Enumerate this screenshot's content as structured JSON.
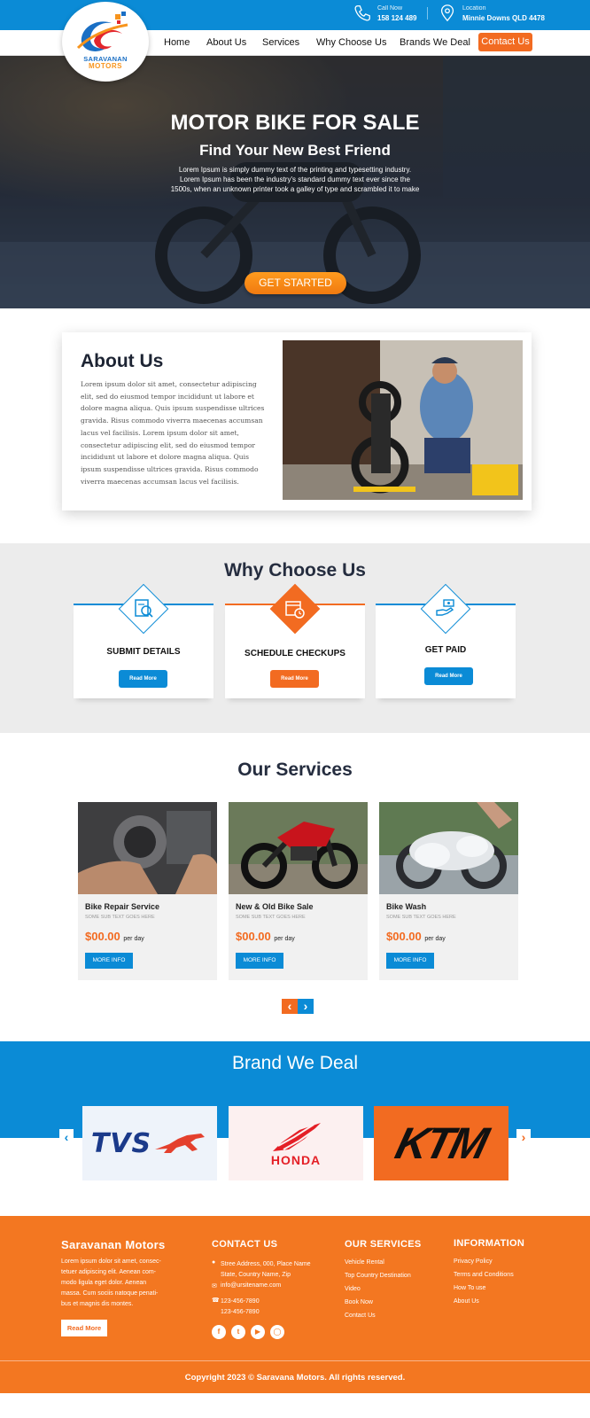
{
  "topbar": {
    "call_label": "Call Now",
    "call_value": "158 124 489",
    "location_label": "Location",
    "location_value": "Minnie Downs QLD 4478"
  },
  "logo": {
    "line1": "SARAVANAN",
    "line2": "MOTORS"
  },
  "nav": {
    "items": [
      "Home",
      "About Us",
      "Services",
      "Why Choose Us",
      "Brands We Deal"
    ],
    "contact": "Contact Us"
  },
  "hero": {
    "title": "MOTOR BIKE FOR SALE",
    "subtitle": "Find Your New Best Friend",
    "text_line1": "Lorem Ipsum is simply dummy text of the printing and typesetting industry.",
    "text_line2": "Lorem Ipsum has been the industry's standard dummy text ever since the",
    "text_line3": "1500s, when an unknown printer took a galley of type and scrambled it to make",
    "button": "GET STARTED"
  },
  "about": {
    "title": "About Us",
    "text": "Lorem ipsum dolor sit amet, consectetur adipiscing elit, sed do eiusmod tempor incididunt ut labore et dolore magna aliqua. Quis ipsum suspendisse ultrices gravida. Risus commodo viverra maecenas accumsan lacus vel facilisis. Lorem ipsum dolor sit amet, consectetur adipiscing elit, sed do eiusmod tempor incididunt ut labore et dolore magna aliqua. Quis ipsum suspendisse ultrices gravida. Risus commodo viverra maecenas accumsan lacus vel facilisis."
  },
  "why": {
    "title": "Why Choose Us",
    "cards": [
      {
        "label": "SUBMIT DETAILS",
        "button": "Read More",
        "icon": "document-search-icon",
        "accent": "#0b8bd6"
      },
      {
        "label": "SCHEDULE CHECKUPS",
        "button": "Read More",
        "icon": "calendar-clock-icon",
        "accent": "#f26b21"
      },
      {
        "label": "GET PAID",
        "button": "Read More",
        "icon": "money-hand-icon",
        "accent": "#0b8bd6"
      }
    ]
  },
  "services": {
    "title": "Our Services",
    "cards": [
      {
        "name": "Bike Repair Service",
        "sub": "SOME SUB TEXT GOES HERE",
        "price": "$00.00",
        "per": "per day",
        "button": "MORE INFO"
      },
      {
        "name": "New & Old Bike Sale",
        "sub": "SOME SUB TEXT GOES HERE",
        "price": "$00.00",
        "per": "per day",
        "button": "MORE INFO"
      },
      {
        "name": "Bike Wash",
        "sub": "SOME SUB TEXT GOES HERE",
        "price": "$00.00",
        "per": "per day",
        "button": "MORE INFO"
      }
    ],
    "prev": "‹",
    "next": "›"
  },
  "brands": {
    "title": "Brand We Deal",
    "items": [
      "TVS",
      "HONDA",
      "KTM"
    ],
    "prev": "‹",
    "next": "›"
  },
  "footer": {
    "company": "Saravanan Motors",
    "about_text_lines": [
      "Lorem ipsum dolor sit amet, consec-",
      "tetuer adipiscing elit. Aenean com-",
      "modo ligula eget dolor. Aenean",
      "massa. Cum sociis natoque penati-",
      "bus et magnis dis montes."
    ],
    "read_more": "Read More",
    "contact_title": "CONTACT US",
    "address_line1": "Stree Address, 000, Place Name",
    "address_line2": "State, Country Name, Zip",
    "email": "info@ursitename.com",
    "phone1": "123-456-7890",
    "phone2": "123-456-7890",
    "services_title": "OUR SERVICES",
    "services_links": [
      "Vehicle Rental",
      "Top Country Destination",
      "Video",
      "Book Now",
      "Contact Us"
    ],
    "info_title": "INFORMATION",
    "info_links": [
      "Privacy Policy",
      "Terms and Conditions",
      "How To use",
      "About Us"
    ],
    "socials": [
      "facebook-icon",
      "twitter-icon",
      "youtube-icon",
      "instagram-icon"
    ],
    "copyright": "Copyright 2023 © Saravana Motors. All rights reserved."
  },
  "colors": {
    "blue": "#0b8bd6",
    "orange": "#f26b21",
    "footer": "#f37721",
    "dark": "#252d3f"
  }
}
